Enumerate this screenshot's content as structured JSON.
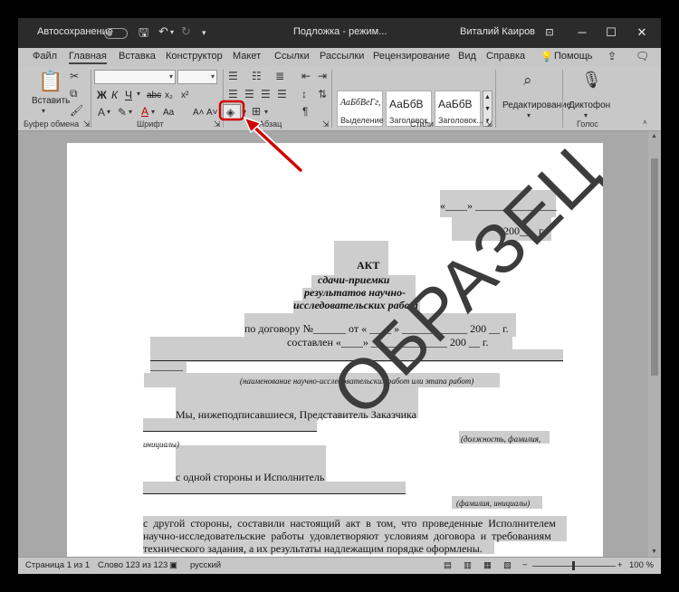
{
  "titlebar": {
    "autosave_label": "Автосохранение",
    "doc_title": "Подложка  -  режим...",
    "user_name": "Виталий Каиров"
  },
  "menu": {
    "tabs": [
      "Файл",
      "Главная",
      "Вставка",
      "Конструктор",
      "Макет",
      "Ссылки",
      "Рассылки",
      "Рецензирование",
      "Вид",
      "Справка",
      "Помощь"
    ]
  },
  "ribbon": {
    "paste_label": "Вставить",
    "clipboard_group": "Буфер обмена",
    "font_group": "Шрифт",
    "paragraph_group": "Абзац",
    "styles_group": "Стили",
    "voice_group": "Голос",
    "bold": "Ж",
    "italic": "К",
    "underline": "Ч",
    "strike": "abc",
    "subscript": "x₂",
    "superscript": "x²",
    "font_grow": "A˄",
    "font_shrink": "A˅",
    "change_case": "Aa",
    "styles": [
      {
        "preview": "АаБбВеГг,",
        "name": "Выделение"
      },
      {
        "preview": "АаБбВ",
        "name": "Заголовок"
      },
      {
        "preview": "АаБбВ",
        "name": "Заголовок..."
      }
    ],
    "editing_label": "Редактирование",
    "dictate_label": "Диктофон"
  },
  "document": {
    "date_line": "«____» _______________",
    "year_line": "200___  г.",
    "act_title": "АКТ",
    "act_sub1": "сдачи-приемки",
    "act_sub2": "результатов научно-",
    "act_sub3": "исследовательских работ",
    "contract_line": "по договору №______ от « ____ » ____________ 200 __ г.",
    "compiled_line": "составлен «____» ______________  200 __  г.",
    "short_line": "______",
    "work_caption": "(наименование научно-исследовательских работ или этапа работ)",
    "we_line": "Мы, нижеподписавшиеся, Представитель Заказчика",
    "position_caption": "(должность, фамилия,",
    "initials_caption": "инициалы)",
    "one_side": "с одной стороны и Исполнитель",
    "fio_caption": "(фамилия, инициалы)",
    "para1": "с другой стороны, составили настоящий акт в том, что проведенные Исполнителем",
    "para2": "научно-исследовательские работы удовлетворяют условиям договора и требованиям",
    "para3": "технического задания, а их результаты надлежащим порядке оформлены.",
    "watermark": "ОБРАЗЕЦ"
  },
  "status": {
    "page": "Страница 1 из 1",
    "words": "Слово 123 из 123",
    "language": "русский",
    "zoom": "100 %"
  }
}
